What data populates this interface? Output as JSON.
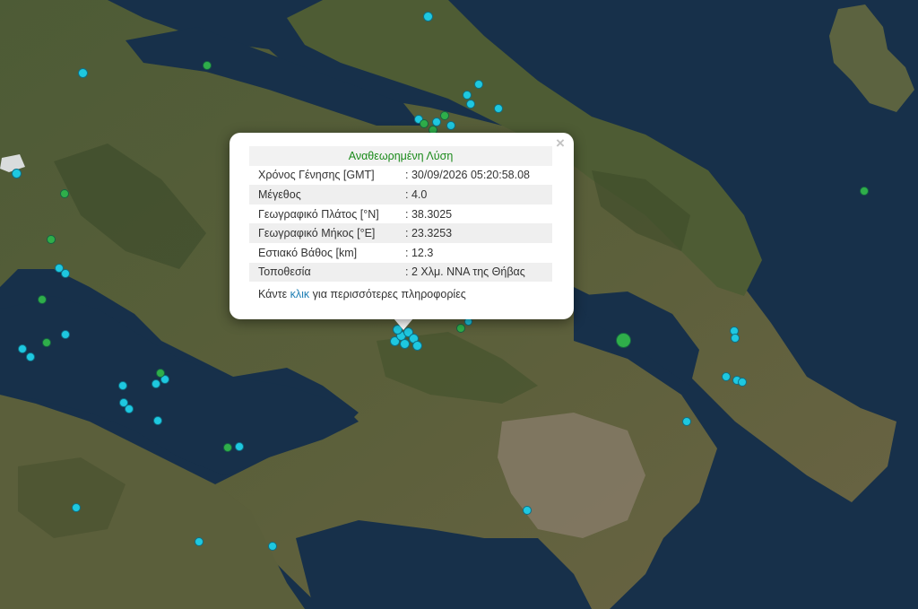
{
  "popup": {
    "title": "Αναθεωρημένη Λύση",
    "close_symbol": "×",
    "rows": [
      {
        "label": "Χρόνος Γένησης [GMT]",
        "value": ": 30/09/2026 05:20:58.08"
      },
      {
        "label": "Μέγεθος",
        "value": ": 4.0"
      },
      {
        "label": "Γεωγραφικό Πλάτος [°N]",
        "value": ": 38.3025"
      },
      {
        "label": "Γεωγραφικό Μήκος [°E]",
        "value": ": 23.3253"
      },
      {
        "label": "Εστιακό Βάθος [km]",
        "value": ": 12.3"
      },
      {
        "label": "Τοποθεσία",
        "value": ": 2 Χλμ. ΝΝΑ της Θήβας"
      }
    ],
    "more_prefix": "Κάντε ",
    "more_link": "κλικ",
    "more_suffix": " για περισσότερες πληροφορίες"
  },
  "colors": {
    "recent_event": "#1ec8e0",
    "older_event": "#2fae4a",
    "title_text": "#1a8a1a",
    "link": "#1f7fb4"
  },
  "icons": {
    "close": "close-icon",
    "event_marker": "circle-marker"
  }
}
